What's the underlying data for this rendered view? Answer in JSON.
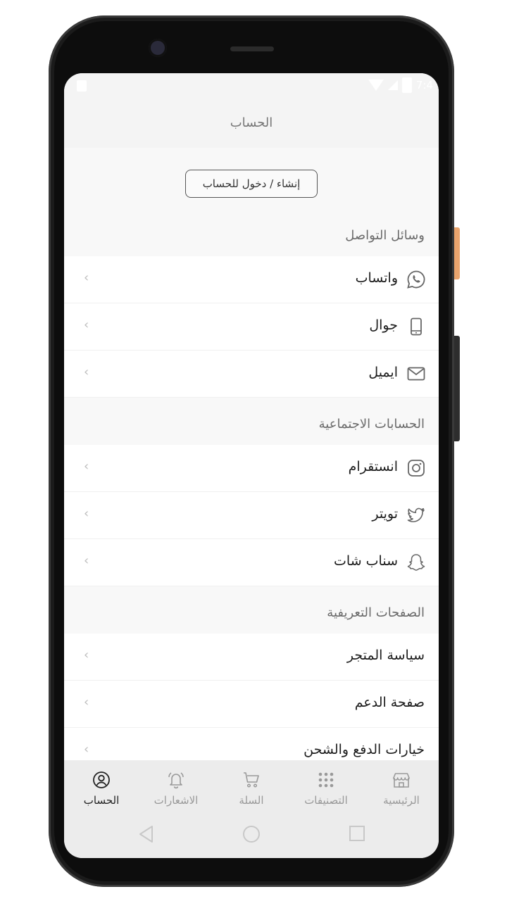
{
  "status": {
    "time": "7:4"
  },
  "header": {
    "title": "الحساب"
  },
  "login_button": "إنشاء / دخول للحساب",
  "sections": [
    {
      "title": "وسائل التواصل",
      "items": [
        {
          "label": "واتساب",
          "icon": "whatsapp-icon"
        },
        {
          "label": "جوال",
          "icon": "mobile-phone-icon"
        },
        {
          "label": "ايميل",
          "icon": "email-icon"
        }
      ]
    },
    {
      "title": "الحسابات الاجتماعية",
      "items": [
        {
          "label": "انستقرام",
          "icon": "instagram-icon"
        },
        {
          "label": "تويتر",
          "icon": "twitter-icon"
        },
        {
          "label": "سناب شات",
          "icon": "snapchat-icon"
        }
      ]
    },
    {
      "title": "الصفحات التعريفية",
      "items": [
        {
          "label": "سياسة المتجر"
        },
        {
          "label": "صفحة الدعم"
        },
        {
          "label": "خيارات الدفع والشحن"
        }
      ]
    }
  ],
  "chevron": "‹",
  "bottom_nav": [
    {
      "label": "الرئيسية",
      "icon": "store-icon"
    },
    {
      "label": "التصنيفات",
      "icon": "grid-icon"
    },
    {
      "label": "السلة",
      "icon": "cart-icon"
    },
    {
      "label": "الاشعارات",
      "icon": "bell-icon"
    },
    {
      "label": "الحساب",
      "icon": "account-icon",
      "active": true
    }
  ],
  "colors": {
    "accent_side_button": "#e9a46d",
    "active_tab": "#222222",
    "inactive_tab": "#999999"
  }
}
